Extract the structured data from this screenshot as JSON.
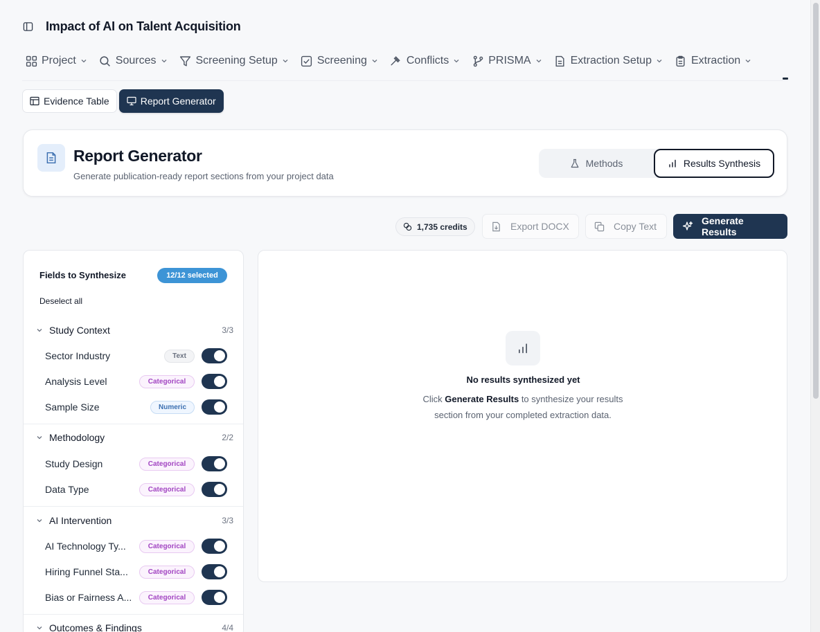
{
  "project_title": "Impact of AI on Talent Acquisition",
  "nav": [
    {
      "label": "Project",
      "icon": "grid-icon"
    },
    {
      "label": "Sources",
      "icon": "search-icon"
    },
    {
      "label": "Screening Setup",
      "icon": "filter-icon"
    },
    {
      "label": "Screening",
      "icon": "checkbox-icon"
    },
    {
      "label": "Conflicts",
      "icon": "gavel-icon"
    },
    {
      "label": "PRISMA",
      "icon": "git-branch-icon"
    },
    {
      "label": "Extraction Setup",
      "icon": "file-text-icon"
    },
    {
      "label": "Extraction",
      "icon": "clipboard-icon"
    }
  ],
  "subtabs": {
    "evidence_table": "Evidence Table",
    "report_generator": "Report Generator"
  },
  "report": {
    "title": "Report Generator",
    "subtitle": "Generate publication-ready report sections from your project data",
    "mode_methods": "Methods",
    "mode_results": "Results Synthesis"
  },
  "actions": {
    "credits": "1,735 credits",
    "export_docx": "Export DOCX",
    "copy_text": "Copy Text",
    "generate": "Generate Results"
  },
  "fields_panel": {
    "title": "Fields to Synthesize",
    "selected_badge": "12/12 selected",
    "deselect_all": "Deselect all",
    "groups": [
      {
        "label": "Study Context",
        "count": "3/3"
      },
      {
        "label": "Methodology",
        "count": "2/2"
      },
      {
        "label": "AI Intervention",
        "count": "3/3"
      },
      {
        "label": "Outcomes & Findings",
        "count": "4/4"
      }
    ],
    "fields": [
      {
        "label": "Sector Industry",
        "tag": "Text",
        "enabled": true
      },
      {
        "label": "Analysis Level",
        "tag": "Categorical",
        "enabled": true
      },
      {
        "label": "Sample Size",
        "tag": "Numeric",
        "enabled": true
      },
      {
        "label": "Study Design",
        "tag": "Categorical",
        "enabled": true
      },
      {
        "label": "Data Type",
        "tag": "Categorical",
        "enabled": true
      },
      {
        "label": "AI Technology Ty...",
        "tag": "Categorical",
        "enabled": true
      },
      {
        "label": "Hiring Funnel Sta...",
        "tag": "Categorical",
        "enabled": true
      },
      {
        "label": "Bias or Fairness A...",
        "tag": "Categorical",
        "enabled": true
      }
    ]
  },
  "empty_state": {
    "title": "No results synthesized yet",
    "desc_prefix": "Click ",
    "desc_bold": "Generate Results",
    "desc_suffix": " to synthesize your results section from your completed extraction data."
  },
  "colors": {
    "primary": "#1f3551",
    "badge_blue": "#3d94d6",
    "categorical_tag": "#a245c2",
    "numeric_tag": "#3b6fb0"
  }
}
